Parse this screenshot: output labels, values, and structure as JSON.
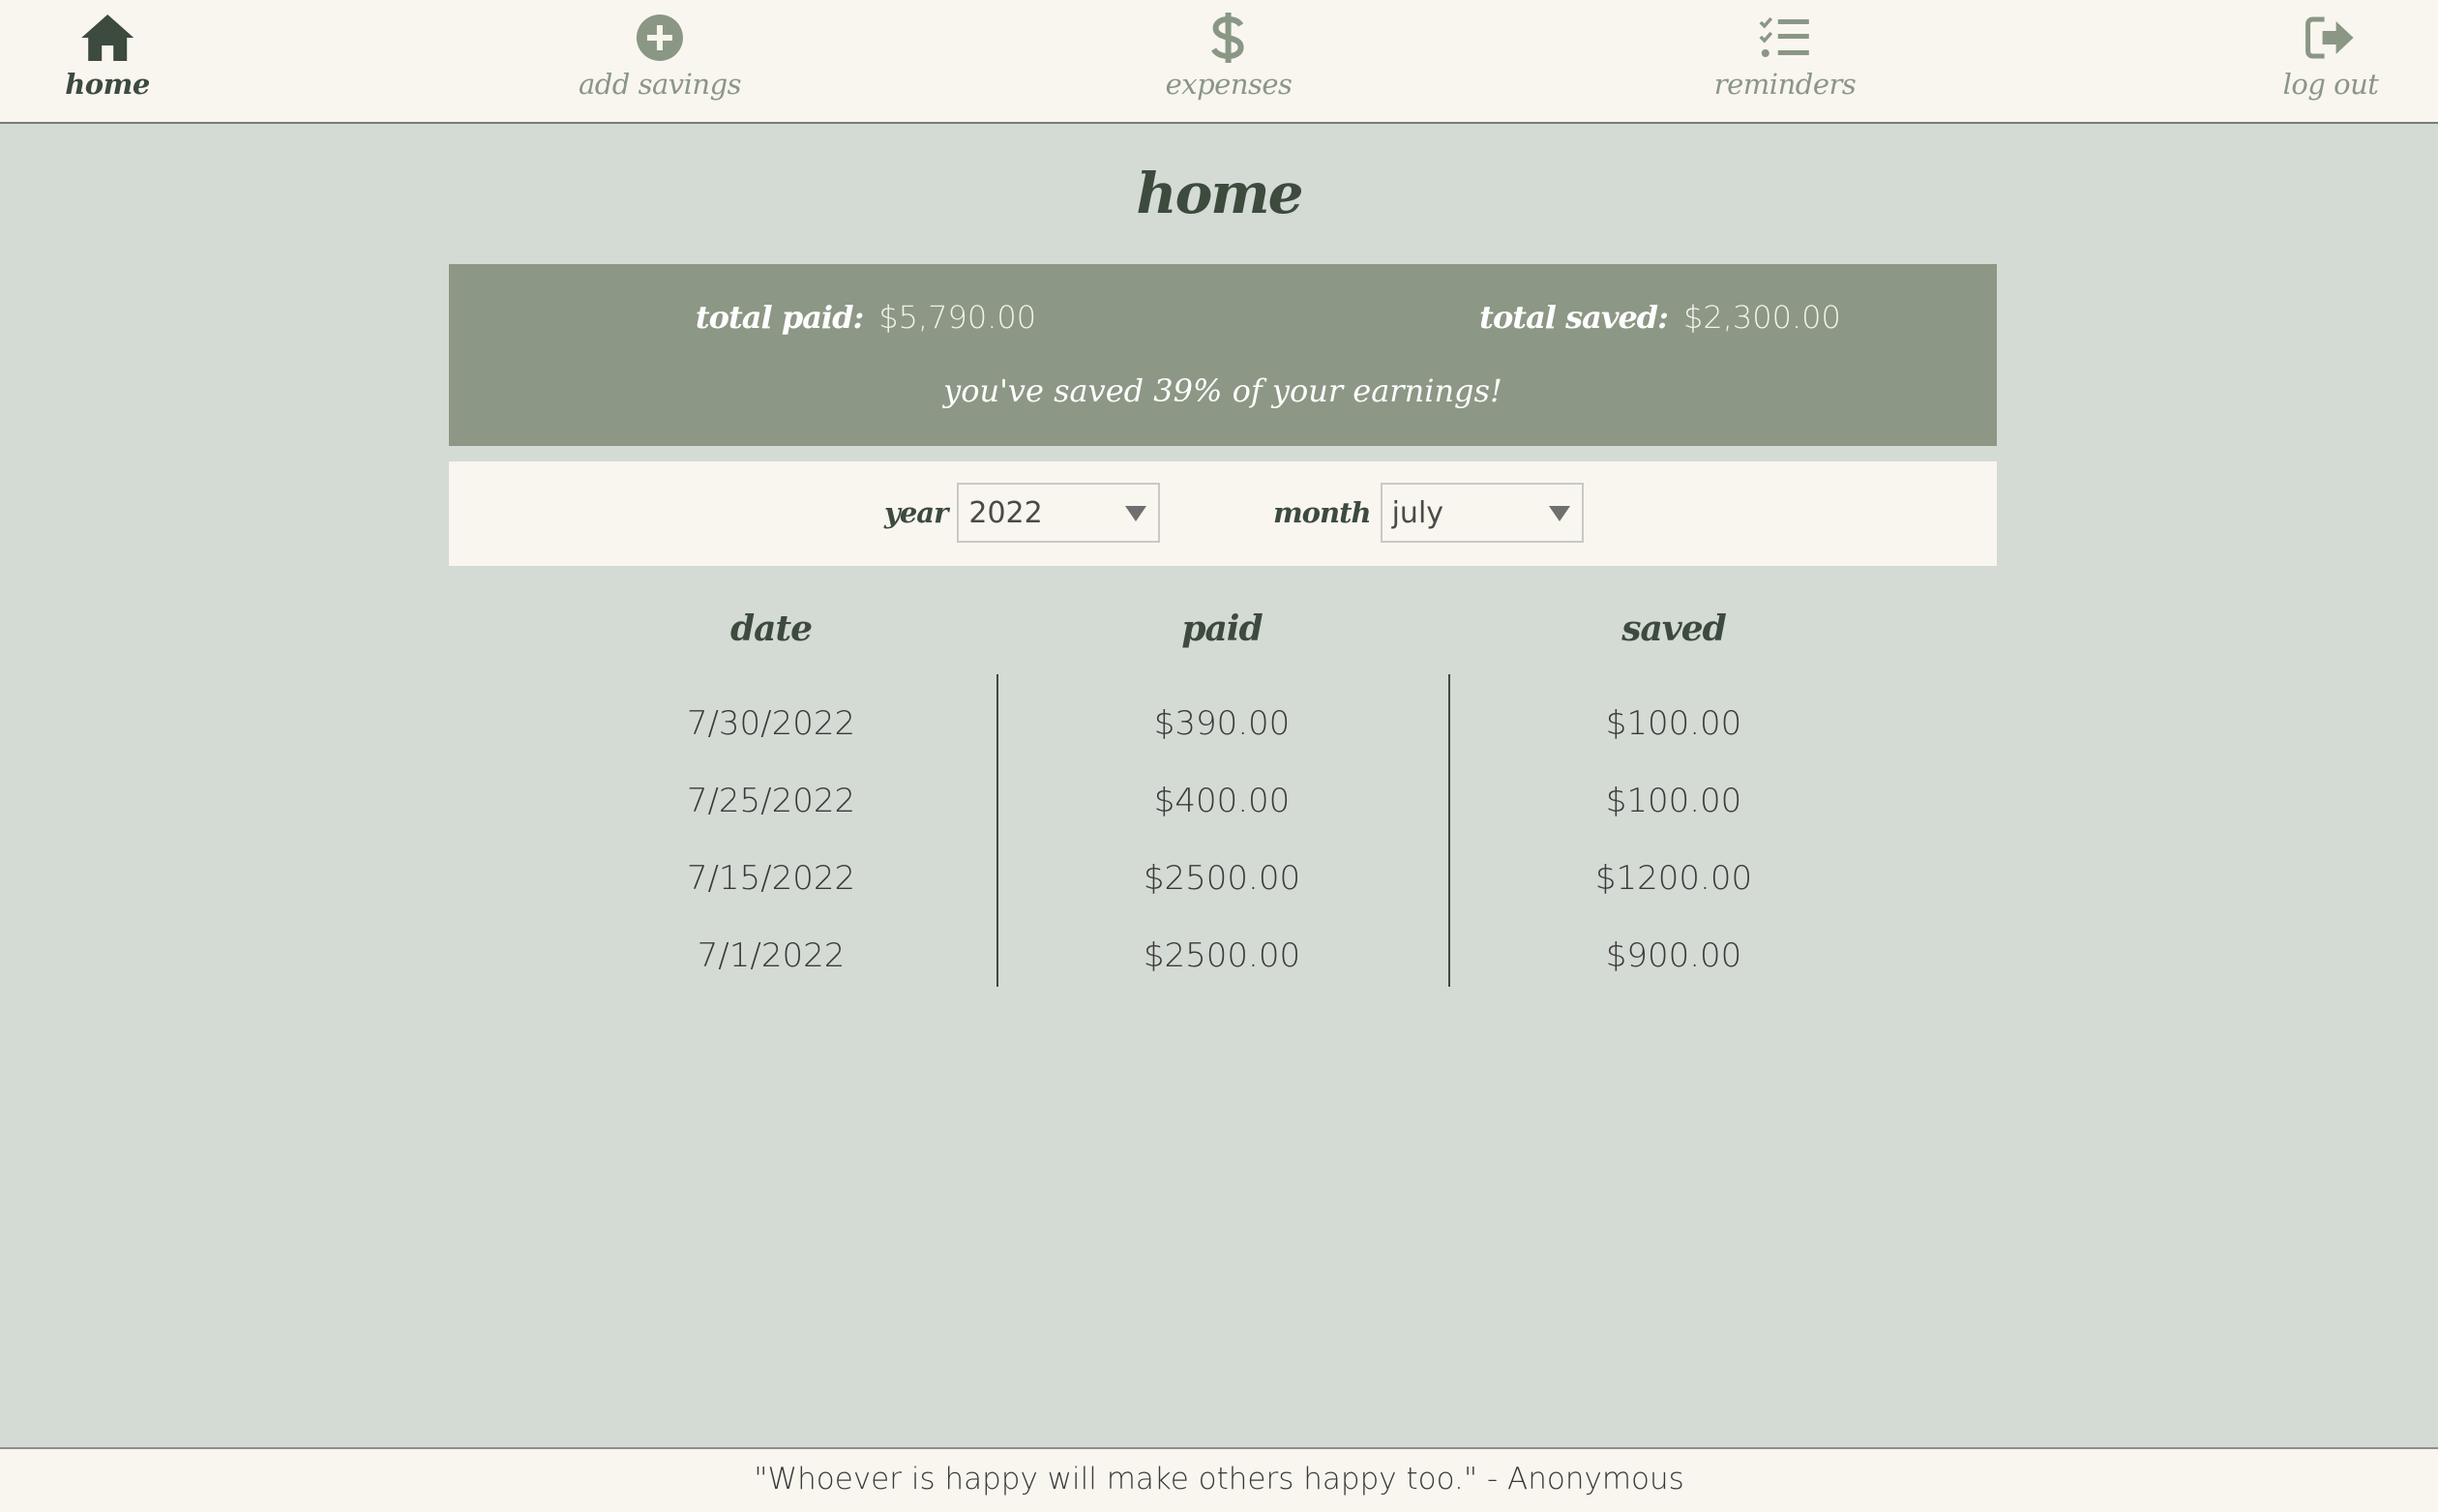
{
  "nav": {
    "items": [
      {
        "label": "home",
        "icon": "house-icon",
        "active": true
      },
      {
        "label": "add savings",
        "icon": "plus-circle-icon",
        "active": false
      },
      {
        "label": "expenses",
        "icon": "dollar-icon",
        "active": false
      },
      {
        "label": "reminders",
        "icon": "checklist-icon",
        "active": false
      },
      {
        "label": "log out",
        "icon": "sign-out-icon",
        "active": false
      }
    ]
  },
  "page": {
    "title": "home"
  },
  "summary": {
    "total_paid_label": "total paid:",
    "total_paid_value": "$5,790.00",
    "total_saved_label": "total saved:",
    "total_saved_value": "$2,300.00",
    "message": "you've saved 39% of your earnings!"
  },
  "filters": {
    "year": {
      "label": "year",
      "value": "2022"
    },
    "month": {
      "label": "month",
      "value": "july"
    }
  },
  "table": {
    "headers": [
      "date",
      "paid",
      "saved"
    ],
    "rows": [
      {
        "date": "7/30/2022",
        "paid": "$390.00",
        "saved": "$100.00"
      },
      {
        "date": "7/25/2022",
        "paid": "$400.00",
        "saved": "$100.00"
      },
      {
        "date": "7/15/2022",
        "paid": "$2500.00",
        "saved": "$1200.00"
      },
      {
        "date": "7/1/2022",
        "paid": "$2500.00",
        "saved": "$900.00"
      }
    ]
  },
  "footer": {
    "quote": "\"Whoever is happy will make others happy too.\" - Anonymous"
  },
  "colors": {
    "background": "#d4dad4",
    "surface": "#f9f6ef",
    "accent": "#8c9785",
    "text_dark": "#3d4a3e",
    "nav_inactive": "#8a9785"
  }
}
